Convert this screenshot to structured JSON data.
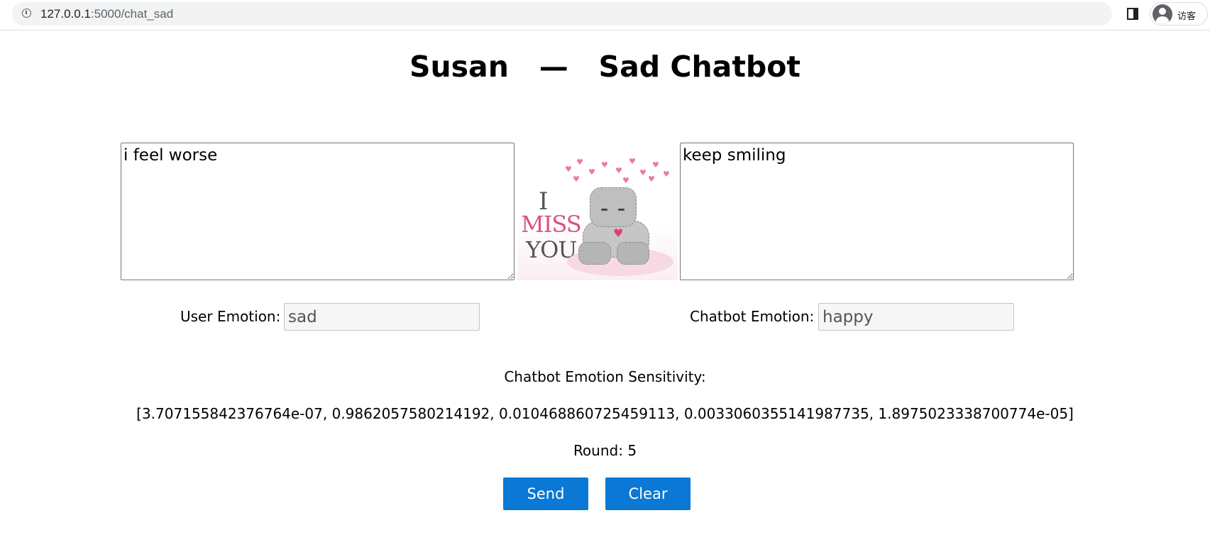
{
  "browser": {
    "url_host": "127.0.0.1",
    "url_path": ":5000/chat_sad",
    "profile_label": "访客"
  },
  "page": {
    "title": "Susan   —   Sad Chatbot"
  },
  "chat": {
    "user_message": "i feel worse",
    "bot_message": "keep smiling"
  },
  "image": {
    "text_i": "I",
    "text_miss": "MISS",
    "text_you": "YOU"
  },
  "emotions": {
    "user_label": "User Emotion:",
    "user_value": "sad",
    "bot_label": "Chatbot Emotion:",
    "bot_value": "happy"
  },
  "sensitivity": {
    "title": "Chatbot Emotion Sensitivity:",
    "values": "[3.707155842376764e-07, 0.9862057580214192, 0.010468860725459113, 0.0033060355141987735, 1.8975023338700774e-05]"
  },
  "round": {
    "text": "Round: 5"
  },
  "actions": {
    "send_label": "Send",
    "clear_label": "Clear"
  }
}
